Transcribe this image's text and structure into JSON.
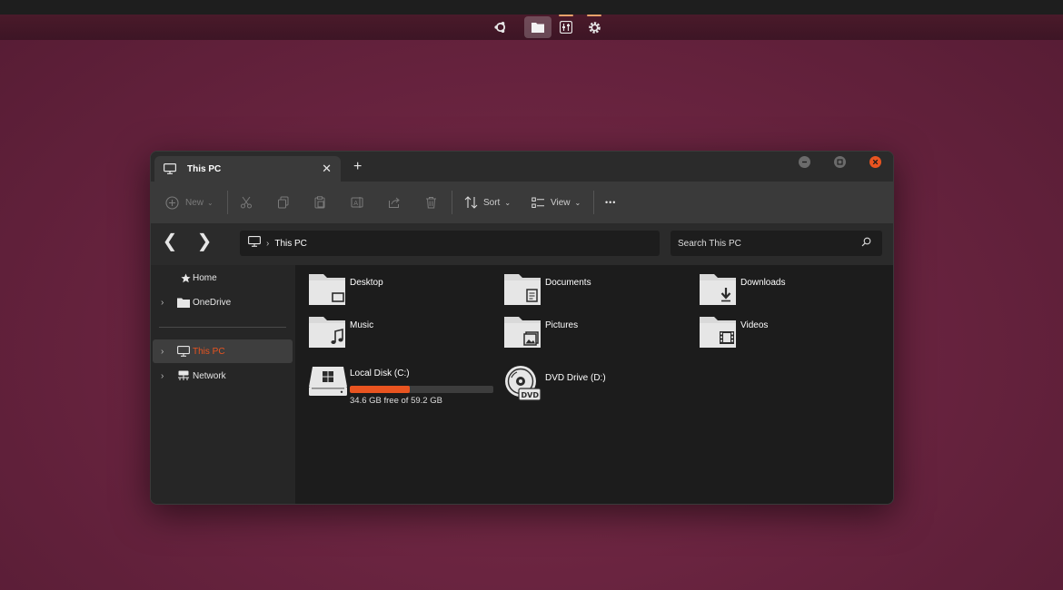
{
  "dock": {
    "items": [
      {
        "name": "ubuntu-logo-icon"
      },
      {
        "name": "files-icon",
        "active": true
      },
      {
        "name": "mixer-icon"
      },
      {
        "name": "settings-icon"
      }
    ]
  },
  "window": {
    "tab_title": "This PC",
    "new_tab_symbol": "+",
    "close_tab_symbol": "✕"
  },
  "toolbar": {
    "new_label": "New",
    "sort_label": "Sort",
    "view_label": "View",
    "more_symbol": "•••",
    "icons": [
      "cut-icon",
      "copy-icon",
      "paste-icon",
      "rename-icon",
      "share-icon",
      "delete-icon"
    ]
  },
  "navbar": {
    "back_symbol": "❮",
    "forward_symbol": "❯",
    "address_separator": "›",
    "address_crumb": "This PC",
    "search_placeholder": "Search This PC"
  },
  "sidebar": {
    "items": [
      {
        "label": "Home",
        "icon": "star-icon"
      },
      {
        "label": "OneDrive",
        "icon": "folder-icon"
      },
      {
        "label": "This PC",
        "icon": "monitor-icon",
        "selected": true
      },
      {
        "label": "Network",
        "icon": "network-icon"
      }
    ]
  },
  "content": {
    "folders": [
      {
        "label": "Desktop",
        "icon": "desktop-folder-icon"
      },
      {
        "label": "Documents",
        "icon": "documents-folder-icon"
      },
      {
        "label": "Downloads",
        "icon": "downloads-folder-icon"
      },
      {
        "label": "Music",
        "icon": "music-folder-icon"
      },
      {
        "label": "Pictures",
        "icon": "pictures-folder-icon"
      },
      {
        "label": "Videos",
        "icon": "videos-folder-icon"
      }
    ],
    "drives": [
      {
        "label": "Local Disk (C:)",
        "usage_text": "34.6 GB free of 59.2 GB",
        "used_fraction": 0.42,
        "icon": "hard-drive-icon"
      },
      {
        "label": "DVD Drive (D:)",
        "icon": "dvd-drive-icon",
        "badge": "DVD"
      }
    ]
  },
  "colors": {
    "accent": "#e95420",
    "window_bg": "#202020",
    "toolbar_bg": "#3a3a3a"
  }
}
